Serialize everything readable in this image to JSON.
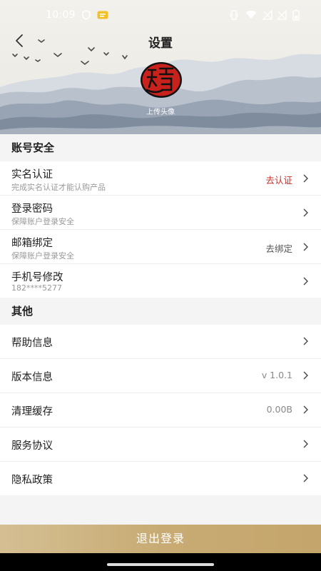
{
  "status": {
    "time": "10:09"
  },
  "header": {
    "title": "设置",
    "upload_label": "上传头像"
  },
  "sections": {
    "account": {
      "title": "账号安全",
      "items": [
        {
          "label": "实名认证",
          "sub": "完成实名认证才能认购产品",
          "value": "去认证"
        },
        {
          "label": "登录密码",
          "sub": "保障账户登录安全",
          "value": ""
        },
        {
          "label": "邮箱绑定",
          "sub": "保障账户登录安全",
          "value": "去绑定"
        },
        {
          "label": "手机号修改",
          "sub": "182****5277",
          "value": ""
        }
      ]
    },
    "other": {
      "title": "其他",
      "items": [
        {
          "label": "帮助信息",
          "value": ""
        },
        {
          "label": "版本信息",
          "value": "v 1.0.1"
        },
        {
          "label": "清理缓存",
          "value": "0.00B"
        },
        {
          "label": "服务协议",
          "value": ""
        },
        {
          "label": "隐私政策",
          "value": ""
        }
      ]
    }
  },
  "logout_label": "退出登录",
  "colors": {
    "accent_red": "#c2312b",
    "gold": "#c8ab74"
  }
}
